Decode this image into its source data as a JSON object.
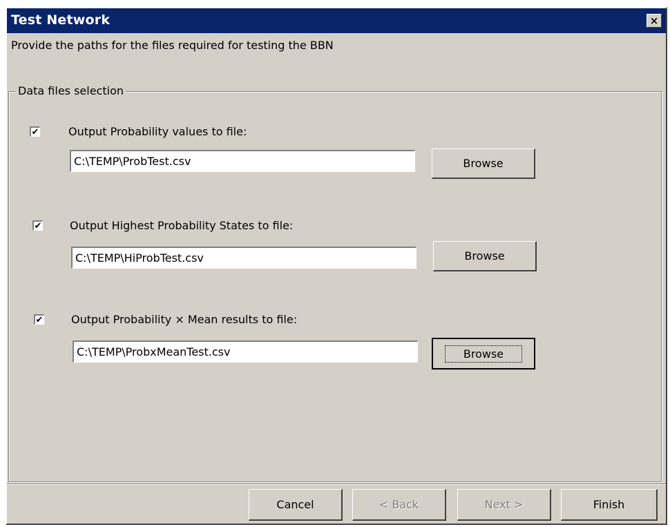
{
  "window": {
    "title": "Test Network",
    "close_label": "×"
  },
  "header": {
    "subtitle": "Provide the paths for the files required for testing the BBN"
  },
  "group": {
    "label": "Data files selection",
    "rows": [
      {
        "checked": true,
        "label": "Output Probability values to file:",
        "path": "C:\\TEMP\\ProbTest.csv",
        "browse_label": "Browse"
      },
      {
        "checked": true,
        "label": "Output Highest Probability States to file:",
        "path": "C:\\TEMP\\HiProbTest.csv",
        "browse_label": "Browse"
      },
      {
        "checked": true,
        "label": "Output Probability × Mean results to file:",
        "path": "C:\\TEMP\\ProbxMeanTest.csv",
        "browse_label": "Browse"
      }
    ]
  },
  "checkmark": "✔",
  "footer": {
    "cancel_label": "Cancel",
    "back_label": "< Back",
    "next_label": "Next >",
    "finish_label": "Finish"
  },
  "colors": {
    "titlebar": "#0a246a",
    "dialog_bg": "#d4d0c8"
  }
}
